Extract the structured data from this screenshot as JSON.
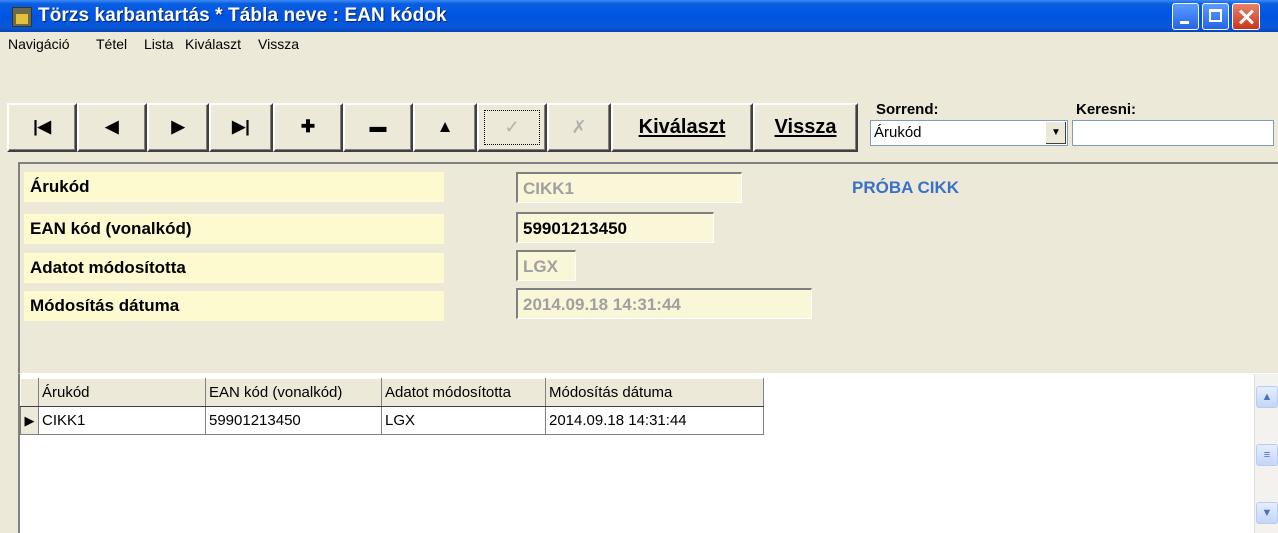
{
  "window": {
    "title": "Törzs karbantartás * Tábla neve : EAN kódok"
  },
  "menu": [
    {
      "label": "Navigáció"
    },
    {
      "label": "Tétel"
    },
    {
      "label": "Lista"
    },
    {
      "label": "Kiválaszt"
    },
    {
      "label": "Vissza"
    }
  ],
  "toolbar": {
    "icons": {
      "first": "◄ first-record-icon",
      "prev": "previous-record-icon",
      "next": "next-record-icon",
      "last": "last-record-icon",
      "add": "add-record-icon",
      "delete": "delete-record-icon",
      "edit": "edit-record-icon",
      "post": "post-icon",
      "cancel": "cancel-icon"
    },
    "select_label": "Kiválaszt",
    "back_label": "Vissza",
    "sort_label": "Sorrend:",
    "sort_value": "Árukód",
    "search_label": "Keresni:",
    "search_value": ""
  },
  "form": {
    "fields": [
      {
        "label": "Árukód",
        "value": "CIKK1"
      },
      {
        "label": "EAN kód (vonalkód)",
        "value": "59901213450"
      },
      {
        "label": "Adatot módosította",
        "value": "LGX"
      },
      {
        "label": "Módosítás dátuma",
        "value": "2014.09.18 14:31:44"
      }
    ],
    "product_name": "PRÓBA CIKK"
  },
  "grid": {
    "columns": [
      "Árukód",
      "EAN kód (vonalkód)",
      "Adatot módosította",
      "Módosítás dátuma"
    ],
    "rows": [
      [
        "CIKK1",
        "59901213450",
        "LGX",
        "2014.09.18 14:31:44"
      ]
    ]
  }
}
